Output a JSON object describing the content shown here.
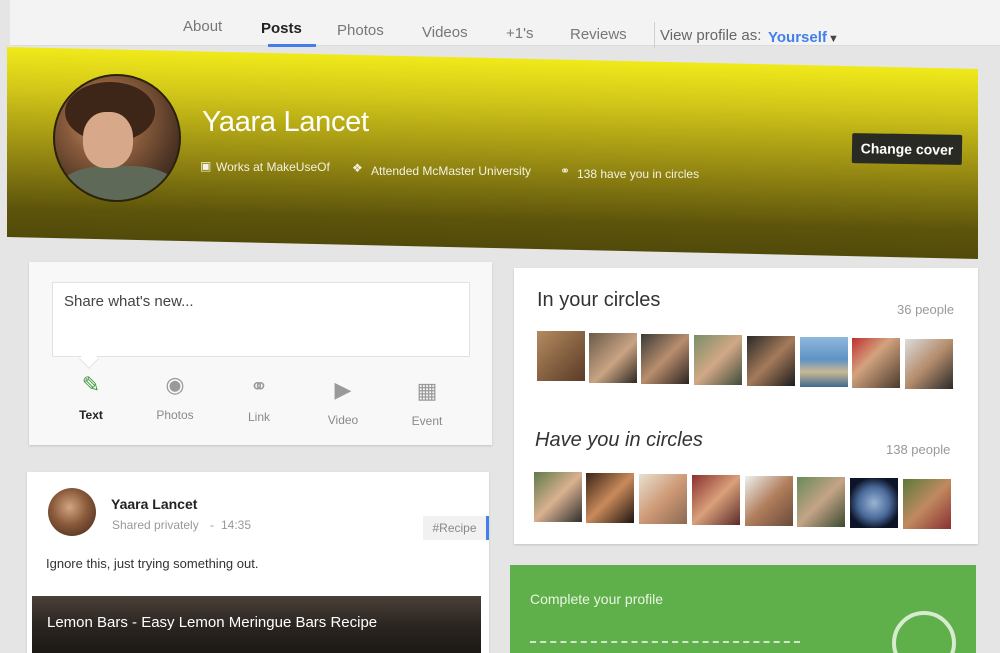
{
  "nav": {
    "tabs": [
      {
        "label": "About"
      },
      {
        "label": "Posts"
      },
      {
        "label": "Photos"
      },
      {
        "label": "Videos"
      },
      {
        "label": "+1's"
      },
      {
        "label": "Reviews"
      }
    ],
    "view_as_label": "View profile as:",
    "view_as_value": "Yourself"
  },
  "profile": {
    "name": "Yaara Lancet",
    "works_at": "Works at MakeUseOf",
    "attended": "Attended McMaster University",
    "in_circles": "138 have you in circles",
    "change_cover_label": "Change cover",
    "cover_colors": {
      "top": "#f0ea1a",
      "bottom": "#514a0a"
    }
  },
  "share": {
    "placeholder": "Share what's new...",
    "actions": [
      {
        "label": "Text",
        "icon": "pencil-icon",
        "active": true
      },
      {
        "label": "Photos",
        "icon": "camera-icon"
      },
      {
        "label": "Link",
        "icon": "link-icon"
      },
      {
        "label": "Video",
        "icon": "video-icon"
      },
      {
        "label": "Event",
        "icon": "event-icon"
      }
    ]
  },
  "post": {
    "author": "Yaara Lancet",
    "visibility": "Shared privately",
    "separator": "-",
    "time": "14:35",
    "tag": "#Recipe",
    "text": "Ignore this, just trying something out.",
    "link_title": "Lemon Bars - Easy Lemon Meringue Bars Recipe"
  },
  "circles": {
    "in_your_circles_title": "In your circles",
    "in_your_circles_count": "36 people",
    "have_you_title": "Have you in circles",
    "have_you_count": "138 people"
  },
  "complete_profile": {
    "label": "Complete your profile"
  },
  "colors": {
    "accent": "#427fed",
    "complete_green": "#5fb04a"
  }
}
